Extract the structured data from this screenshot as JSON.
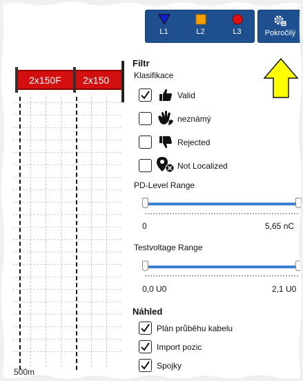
{
  "toolbar": {
    "phases": [
      {
        "label": "L1",
        "color": "#1020d0",
        "shape": "triangle-down"
      },
      {
        "label": "L2",
        "color": "#f5a000",
        "shape": "square"
      },
      {
        "label": "L3",
        "color": "#e01010",
        "shape": "circle"
      }
    ],
    "advanced_label": "Pokročilý",
    "advanced_icon": "gear-settings-icon"
  },
  "plot": {
    "segments": [
      "2x150F",
      "2x150"
    ],
    "x_axis_label": "500m"
  },
  "filter": {
    "title": "Filtr",
    "classification_label": "Klasifikace",
    "classes": [
      {
        "label": "Valid",
        "checked": true,
        "icon": "thumbs-up-icon"
      },
      {
        "label": "neznámý",
        "checked": false,
        "icon": "waving-hands-icon"
      },
      {
        "label": "Rejected",
        "checked": false,
        "icon": "thumbs-down-icon"
      },
      {
        "label": "Not Localized",
        "checked": false,
        "icon": "location-off-icon"
      }
    ],
    "pd_range": {
      "label": "PD-Level Range",
      "min": "0",
      "max": "5,65 nC",
      "low": 0.0,
      "high": 1.0
    },
    "voltage_range": {
      "label": "Testvoltage Range",
      "min": "0,0 U0",
      "max": "2,1 U0",
      "low": 0.0,
      "high": 1.0
    }
  },
  "preview": {
    "title": "Náhled",
    "items": [
      {
        "label": "Plán průběhu kabelu",
        "checked": true
      },
      {
        "label": "Import pozic",
        "checked": true
      },
      {
        "label": "Spojky",
        "checked": true
      }
    ]
  },
  "colors": {
    "toolbar_bg": "#1e4f8f",
    "cable": "#d40f0f",
    "slider": "#3b7fd4",
    "highlight_arrow": "#ffff00"
  }
}
